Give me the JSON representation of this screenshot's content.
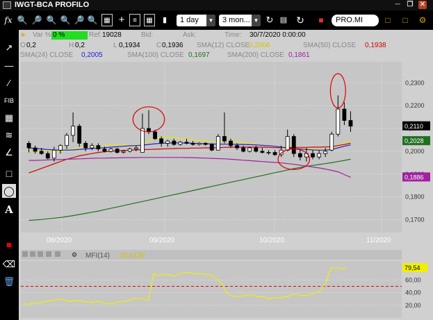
{
  "window": {
    "title": "IWGT-BCA PROFILO"
  },
  "toolbar": {
    "fx": "fx",
    "period": "1 day",
    "range": "3 mon...",
    "symbol": "PRO.MI"
  },
  "info": {
    "var_label": "Var %",
    "var_value": "0 %",
    "ref_label": "Ref:",
    "ref_value": "19028",
    "bid_label": "Bid:",
    "ask_label": "Ask:",
    "time_label": "Time:",
    "time_value": "30/7/2020 0:00:00",
    "o_label": "O",
    "o_value": "0,2",
    "h_label": "H",
    "h_value": "0,2",
    "l_label": "L",
    "l_value": "0,1934",
    "c_label": "C",
    "c_value": "0,1936",
    "sma12_label": "SMA(12) CLOSE",
    "sma12_value": "0,2006",
    "sma50_label": "SMA(50) CLOSE",
    "sma50_value": "0,1938",
    "sma24_label": "SMA(24) CLOSE",
    "sma24_value": "0,2005",
    "sma100_label": "SMA(100) CLOSE",
    "sma100_value": "0,1697",
    "sma200_label": "SMA(200) CLOSE",
    "sma200_value": "0,1861"
  },
  "colors": {
    "sma12": "#e8e800",
    "sma50": "#d00000",
    "sma24": "#2020e0",
    "sma100": "#207020",
    "sma200": "#a020a0",
    "mfi": "#f0f000",
    "var_bg": "#22dd22"
  },
  "price_axis": {
    "ticks": [
      "0,2300",
      "0,2200",
      "0,2100",
      "0,2000",
      "0,1900",
      "0,1800",
      "0,1700"
    ],
    "last": "0,2110",
    "sma_tag": "0,2028",
    "sma200_tag": "0,1886"
  },
  "date_axis": {
    "labels": [
      "08/2020",
      "09/2020",
      "10/2020",
      "11/2020"
    ]
  },
  "mfi": {
    "label": "MFI(14)",
    "value": "30,6139",
    "last": "79,54",
    "ticks": [
      "60,00",
      "40,00",
      "20,00"
    ]
  },
  "chart_data": [
    {
      "type": "candlestick",
      "title": "",
      "ylim": [
        0.165,
        0.238
      ],
      "x_labels": [
        "08/2020",
        "09/2020",
        "10/2020",
        "11/2020"
      ],
      "candles": [
        [
          0.2035,
          0.2045,
          0.1995,
          0.2015
        ],
        [
          0.2015,
          0.2025,
          0.199,
          0.2
        ],
        [
          0.2,
          0.2015,
          0.1985,
          0.199
        ],
        [
          0.199,
          0.2,
          0.1965,
          0.197
        ],
        [
          0.197,
          0.202,
          0.1955,
          0.2005
        ],
        [
          0.2005,
          0.203,
          0.199,
          0.2025
        ],
        [
          0.2025,
          0.208,
          0.201,
          0.207
        ],
        [
          0.207,
          0.217,
          0.204,
          0.211
        ],
        [
          0.211,
          0.212,
          0.202,
          0.2035
        ],
        [
          0.2035,
          0.2045,
          0.2,
          0.2015
        ],
        [
          0.2015,
          0.2035,
          0.2005,
          0.2025
        ],
        [
          0.2025,
          0.2035,
          0.2,
          0.201
        ],
        [
          0.201,
          0.202,
          0.1995,
          0.2
        ],
        [
          0.2,
          0.2015,
          0.1995,
          0.201
        ],
        [
          0.201,
          0.2015,
          0.199,
          0.1995
        ],
        [
          0.1995,
          0.2005,
          0.199,
          0.2
        ],
        [
          0.2,
          0.2015,
          0.1995,
          0.201
        ],
        [
          0.201,
          0.2025,
          0.2,
          0.2015
        ],
        [
          0.1995,
          0.2165,
          0.1995,
          0.21
        ],
        [
          0.21,
          0.218,
          0.2075,
          0.2085
        ],
        [
          0.2085,
          0.2095,
          0.205,
          0.2055
        ],
        [
          0.2055,
          0.2065,
          0.202,
          0.2035
        ],
        [
          0.2035,
          0.205,
          0.202,
          0.2045
        ],
        [
          0.2045,
          0.2055,
          0.2025,
          0.203
        ],
        [
          0.203,
          0.2045,
          0.2025,
          0.204
        ],
        [
          0.204,
          0.2055,
          0.203,
          0.2035
        ],
        [
          0.2035,
          0.2045,
          0.2025,
          0.203
        ],
        [
          0.203,
          0.204,
          0.2025,
          0.2035
        ],
        [
          0.2035,
          0.204,
          0.2025,
          0.203
        ],
        [
          0.203,
          0.2035,
          0.2,
          0.2005
        ],
        [
          0.2005,
          0.2075,
          0.2005,
          0.2065
        ],
        [
          0.2065,
          0.217,
          0.2035,
          0.2045
        ],
        [
          0.2045,
          0.2055,
          0.2015,
          0.2025
        ],
        [
          0.2025,
          0.2035,
          0.2005,
          0.2015
        ],
        [
          0.2015,
          0.2025,
          0.1995,
          0.2
        ],
        [
          0.2,
          0.202,
          0.1995,
          0.2015
        ],
        [
          0.2015,
          0.2025,
          0.1995,
          0.2
        ],
        [
          0.2,
          0.2015,
          0.199,
          0.1995
        ],
        [
          0.1995,
          0.2005,
          0.1985,
          0.1995
        ],
        [
          0.1995,
          0.2005,
          0.198,
          0.1985
        ],
        [
          0.1985,
          0.2025,
          0.1975,
          0.2005
        ],
        [
          0.2005,
          0.2095,
          0.2,
          0.2065
        ],
        [
          0.2065,
          0.2075,
          0.1975,
          0.199
        ],
        [
          0.199,
          0.2005,
          0.196,
          0.1975
        ],
        [
          0.1975,
          0.2015,
          0.1955,
          0.199
        ],
        [
          0.199,
          0.2005,
          0.1965,
          0.1975
        ],
        [
          0.1975,
          0.2005,
          0.1965,
          0.199
        ],
        [
          0.199,
          0.2015,
          0.1975,
          0.2
        ],
        [
          0.2005,
          0.2085,
          0.2,
          0.2075
        ],
        [
          0.2075,
          0.2245,
          0.2065,
          0.2185
        ],
        [
          0.2185,
          0.2215,
          0.2115,
          0.2135
        ],
        [
          0.2135,
          0.2175,
          0.2085,
          0.211
        ]
      ],
      "series": [
        {
          "name": "SMA(12) CLOSE",
          "color": "#e8e800",
          "values": [
            0.2,
            0.2,
            0.2,
            0.2,
            0.2,
            0.2,
            0.2005,
            0.201,
            0.2015,
            0.2018,
            0.202,
            0.2022,
            0.2025,
            0.2027,
            0.2028,
            0.2028,
            0.2027,
            0.2026,
            0.2035,
            0.2045,
            0.2055,
            0.206,
            0.2062,
            0.206,
            0.2057,
            0.2054,
            0.205,
            0.2048,
            0.2045,
            0.2042,
            0.2043,
            0.2045,
            0.2044,
            0.2042,
            0.2038,
            0.2034,
            0.203,
            0.2027,
            0.2024,
            0.2021,
            0.202,
            0.2024,
            0.2022,
            0.2017,
            0.2013,
            0.201,
            0.2008,
            0.2007,
            0.2012,
            0.2025,
            0.2035,
            0.2045
          ]
        },
        {
          "name": "SMA(50) CLOSE",
          "color": "#d00000",
          "values": [
            0.1905,
            0.1915,
            0.1925,
            0.1935,
            0.1945,
            0.1955,
            0.1965,
            0.1972,
            0.198,
            0.1985,
            0.199,
            0.1995,
            0.1998,
            0.2,
            0.2002,
            0.2004,
            0.2005,
            0.2006,
            0.2007,
            0.2008,
            0.2009,
            0.201,
            0.2011,
            0.2012,
            0.2013,
            0.2013,
            0.2014,
            0.2014,
            0.2015,
            0.2015,
            0.2016,
            0.2017,
            0.2018,
            0.2018,
            0.2018,
            0.2018,
            0.2018,
            0.2018,
            0.2017,
            0.2016,
            0.2016,
            0.2017,
            0.2017,
            0.2017,
            0.2017,
            0.2018,
            0.2018,
            0.2019,
            0.202,
            0.2025,
            0.203,
            0.2035
          ]
        },
        {
          "name": "SMA(24) CLOSE",
          "color": "#2020e0",
          "values": [
            0.2015,
            0.2012,
            0.201,
            0.2008,
            0.2006,
            0.2005,
            0.2005,
            0.2006,
            0.2008,
            0.201,
            0.2012,
            0.2014,
            0.2016,
            0.2018,
            0.202,
            0.2022,
            0.2024,
            0.2025,
            0.2027,
            0.203,
            0.2033,
            0.2035,
            0.2036,
            0.2037,
            0.2037,
            0.2036,
            0.2035,
            0.2034,
            0.2033,
            0.2032,
            0.2031,
            0.2031,
            0.2031,
            0.203,
            0.203,
            0.2029,
            0.2028,
            0.2026,
            0.2024,
            0.2022,
            0.2018,
            0.2015,
            0.2012,
            0.201,
            0.2008,
            0.2006,
            0.2005,
            0.2005,
            0.2008,
            0.2015,
            0.2022,
            0.2028
          ]
        },
        {
          "name": "SMA(100) CLOSE",
          "color": "#207020",
          "values": [
            0.1697,
            0.1699,
            0.1701,
            0.1704,
            0.1707,
            0.171,
            0.1714,
            0.1718,
            0.1723,
            0.1728,
            0.1733,
            0.1738,
            0.1744,
            0.175,
            0.1756,
            0.1762,
            0.1768,
            0.1774,
            0.178,
            0.1786,
            0.1792,
            0.1798,
            0.1804,
            0.181,
            0.1816,
            0.1822,
            0.1828,
            0.1834,
            0.184,
            0.1846,
            0.1852,
            0.1858,
            0.1864,
            0.187,
            0.1876,
            0.1882,
            0.1888,
            0.1894,
            0.19,
            0.1906,
            0.1912,
            0.1918,
            0.1924,
            0.1929,
            0.1934,
            0.1938,
            0.1942,
            0.1946,
            0.195,
            0.1955,
            0.196,
            0.1965
          ]
        },
        {
          "name": "SMA(200) CLOSE",
          "color": "#a020a0",
          "values": [
            0.196,
            0.196,
            0.1961,
            0.1962,
            0.1963,
            0.1964,
            0.1965,
            0.1966,
            0.1967,
            0.1968,
            0.1969,
            0.197,
            0.197,
            0.1971,
            0.1971,
            0.1972,
            0.1972,
            0.1972,
            0.1973,
            0.1973,
            0.1973,
            0.1973,
            0.1973,
            0.1973,
            0.1973,
            0.1972,
            0.1972,
            0.1971,
            0.197,
            0.1969,
            0.1968,
            0.1967,
            0.1965,
            0.1963,
            0.1961,
            0.1959,
            0.1957,
            0.1955,
            0.1953,
            0.1951,
            0.1949,
            0.1946,
            0.1943,
            0.1939,
            0.1935,
            0.1931,
            0.1927,
            0.1922,
            0.1916,
            0.191,
            0.1898,
            0.1886
          ]
        }
      ],
      "annotations": [
        {
          "shape": "ellipse",
          "at": [
            19,
            0.214
          ],
          "spanx": 2.5,
          "spany": 0.0055
        },
        {
          "shape": "ellipse",
          "at": [
            42,
            0.1965
          ],
          "spanx": 2.5,
          "spany": 0.0045
        },
        {
          "shape": "ellipse",
          "at": [
            49,
            0.2265
          ],
          "spanx": 1.2,
          "spany": 0.0075
        }
      ]
    },
    {
      "type": "line",
      "title": "MFI(14)",
      "ylim": [
        0,
        90
      ],
      "reference_line": 50,
      "series": [
        {
          "name": "MFI(14)",
          "values": [
            22,
            22,
            24,
            23,
            26,
            27,
            28,
            30,
            28,
            26,
            28,
            27,
            26,
            24,
            26,
            25,
            23,
            22,
            25,
            26,
            27,
            30,
            31,
            30,
            28,
            70,
            67,
            69,
            68,
            66,
            70,
            72,
            71,
            70,
            70,
            69,
            68,
            62,
            55,
            40,
            35,
            33,
            35,
            36,
            37,
            33,
            34,
            30,
            32,
            31,
            33,
            34,
            38,
            36,
            35,
            37,
            40,
            42,
            55,
            78,
            80,
            77,
            79
          ]
        }
      ]
    }
  ]
}
